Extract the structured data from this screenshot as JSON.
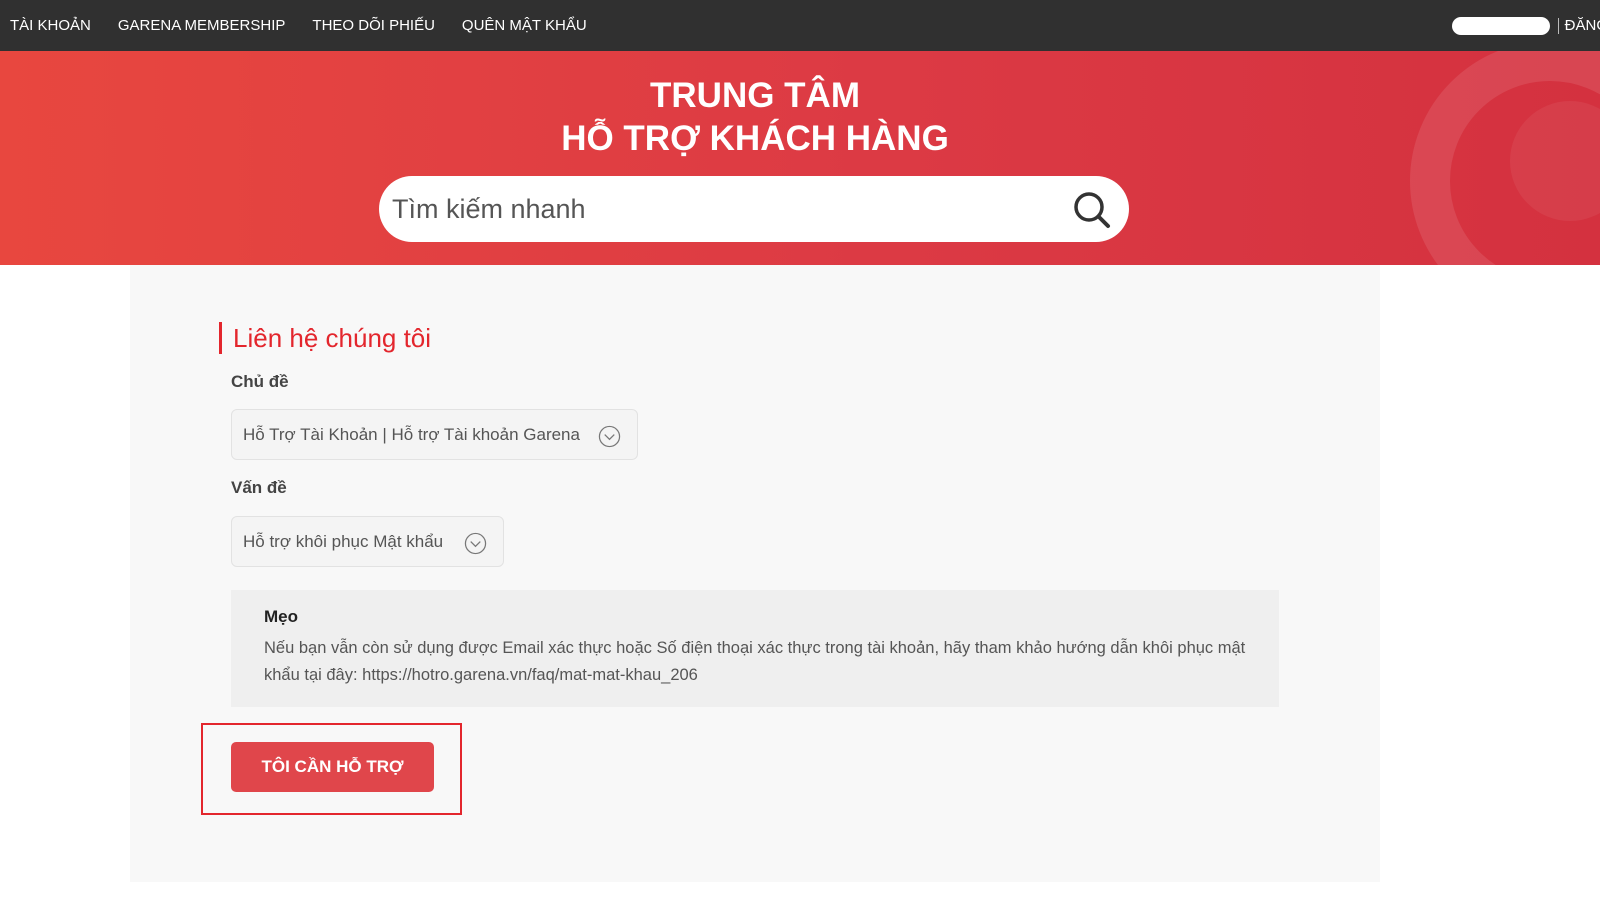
{
  "nav": {
    "items": [
      "TÀI KHOẢN",
      "GARENA MEMBERSHIP",
      "THEO DÕI PHIẾU",
      "QUÊN MẬT KHẨU"
    ],
    "login": "ĐĂNG"
  },
  "hero": {
    "title_line1": "TRUNG TÂM",
    "title_line2": "HỖ TRỢ KHÁCH HÀNG",
    "search_placeholder": "Tìm kiếm nhanh"
  },
  "contact": {
    "title": "Liên hệ chúng tôi",
    "topic_label": "Chủ đề",
    "topic_value": "Hỗ Trợ Tài Khoản | Hỗ trợ Tài khoản Garena",
    "issue_label": "Vấn đề",
    "issue_value": "Hỗ trợ khôi phục Mật khẩu",
    "tip_title": "Mẹo",
    "tip_text": "Nếu bạn vẫn còn sử dụng được Email xác thực hoặc Số điện thoại xác thực trong tài khoản, hãy tham khảo hướng dẫn khôi phục mật khẩu tại đây: https://hotro.garena.vn/faq/mat-mat-khau_206",
    "button": "TÔI CẦN HỖ TRỢ"
  },
  "colors": {
    "accent": "#e3262d",
    "hero": "#dc3a44",
    "nav": "#303030",
    "button": "#e0464b"
  }
}
